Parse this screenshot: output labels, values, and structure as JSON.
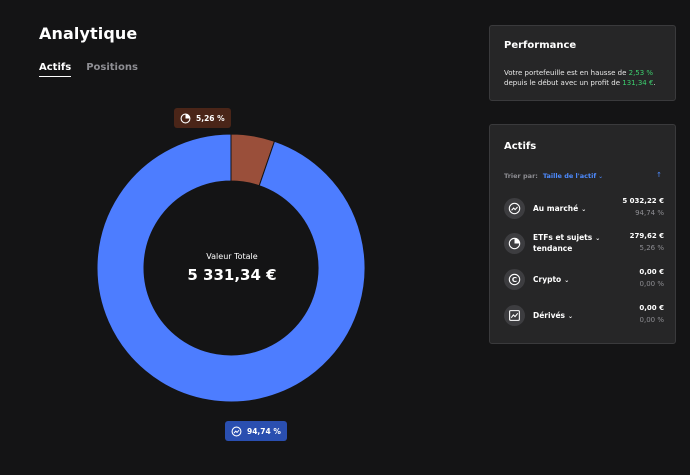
{
  "page": {
    "title": "Analytique"
  },
  "tabs": [
    {
      "label": "Actifs",
      "active": true
    },
    {
      "label": "Positions",
      "active": false
    }
  ],
  "chart_data": {
    "type": "pie",
    "variant": "donut",
    "title": "",
    "center_label": "Valeur Totale",
    "center_value": "5 331,34 €",
    "slices": [
      {
        "name": "Au marché",
        "value": 94.74,
        "label": "94,74 %",
        "color": "#4d7dff",
        "icon": "trend-icon"
      },
      {
        "name": "ETFs et sujets tendance",
        "value": 5.26,
        "label": "5,26 %",
        "color": "#9a4f3a",
        "icon": "pie-chart-icon"
      }
    ]
  },
  "performance": {
    "title": "Performance",
    "text_before": "Votre portefeuille est en hausse de ",
    "pct": "2,53 %",
    "text_middle": " depuis le début avec un profit de ",
    "profit": "131,34 €",
    "text_end": ".",
    "accent_color": "#3ccf6e"
  },
  "assets": {
    "title": "Actifs",
    "sort_label": "Trier par:",
    "sort_value": "Taille de l'actif",
    "sort_direction_icon": "arrow-up-icon",
    "items": [
      {
        "name": "Au marché",
        "amount": "5 032,22 €",
        "pct": "94,74 %",
        "icon": "trend-icon"
      },
      {
        "name_line1": "ETFs et sujets",
        "name_line2": "tendance",
        "amount": "279,62 €",
        "pct": "5,26 %",
        "icon": "pie-chart-icon"
      },
      {
        "name": "Crypto",
        "amount": "0,00 €",
        "pct": "0,00 %",
        "icon": "crypto-icon"
      },
      {
        "name": "Dérivés",
        "amount": "0,00 €",
        "pct": "0,00 %",
        "icon": "derivatives-chart-icon"
      }
    ]
  }
}
